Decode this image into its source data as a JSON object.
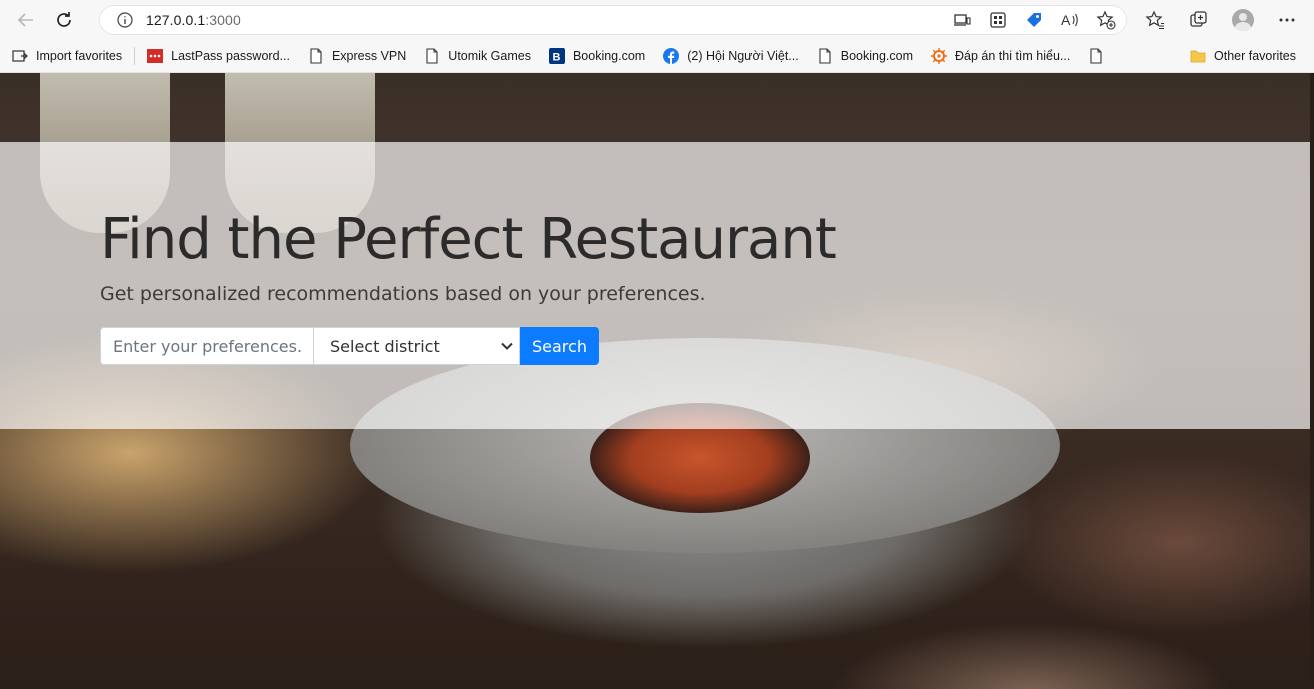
{
  "browser": {
    "url_host": "127.0.0.1",
    "url_port": ":3000",
    "bookmarks": [
      {
        "label": "Import favorites",
        "icon": "import-favorites-icon"
      },
      {
        "label": "LastPass password...",
        "icon": "lastpass-icon"
      },
      {
        "label": "Express VPN",
        "icon": "page-icon"
      },
      {
        "label": "Utomik Games",
        "icon": "page-icon"
      },
      {
        "label": "Booking.com",
        "icon": "booking-icon"
      },
      {
        "label": "(2) Hội Người Việt...",
        "icon": "facebook-icon"
      },
      {
        "label": "Booking.com",
        "icon": "page-icon"
      },
      {
        "label": "Đáp án thi tìm hiểu...",
        "icon": "gear-wheel-icon"
      }
    ],
    "other_favorites": "Other favorites"
  },
  "hero": {
    "title": "Find the Perfect Restaurant",
    "subtitle": "Get personalized recommendations based on your preferences.",
    "preferences_placeholder": "Enter your preferences...",
    "district_selected": "Select district",
    "search_label": "Search"
  },
  "colors": {
    "primary_button": "#0d7bff",
    "overlay_band": "rgba(255,255,255,0.68)",
    "lastpass_red": "#d32d27",
    "booking_blue": "#003580",
    "facebook_blue": "#1877f2"
  }
}
